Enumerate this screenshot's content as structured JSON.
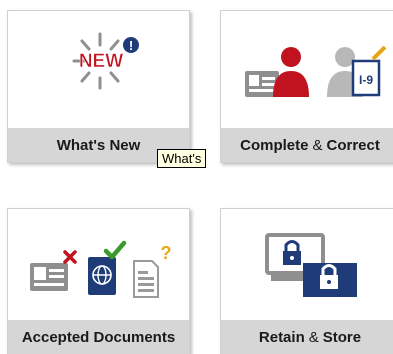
{
  "tiles": [
    {
      "label": "What's New",
      "badge": "NEW"
    },
    {
      "label_a": "Complete",
      "amp": "&",
      "label_b": "Correct",
      "form_tag": "I-9"
    },
    {
      "label": "Accepted Documents"
    },
    {
      "label_a": "Retain",
      "amp": "&",
      "label_b": "Store"
    }
  ],
  "tooltip": "What's",
  "colors": {
    "accent_red": "#c0131f",
    "navy": "#1f3c78",
    "green": "#3a9a2c",
    "gold": "#e8a517",
    "gray": "#8f8f8f",
    "label_bg": "#d6d6d6"
  }
}
